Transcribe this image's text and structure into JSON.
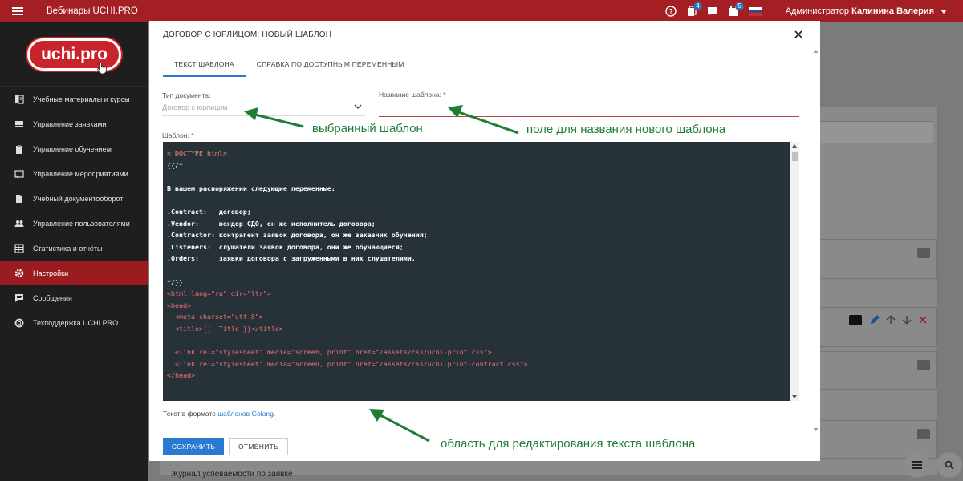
{
  "topbar": {
    "app_title": "Вебинары UCHI.PRO",
    "badge_docs": "4",
    "badge_calendar": "5",
    "user_role": "Администратор",
    "user_name": "Калинина Валерия"
  },
  "sidebar": {
    "logo_text": "uchi.pro",
    "items": [
      {
        "label": "Учебные материалы и курсы",
        "icon": "books-icon"
      },
      {
        "label": "Управление заявками",
        "icon": "list-icon"
      },
      {
        "label": "Управление обучением",
        "icon": "clipboard-icon"
      },
      {
        "label": "Управление мероприятиями",
        "icon": "cast-icon"
      },
      {
        "label": "Учебный документооборот",
        "icon": "document-icon"
      },
      {
        "label": "Управление пользователями",
        "icon": "users-icon"
      },
      {
        "label": "Статистика и отчёты",
        "icon": "table-icon"
      },
      {
        "label": "Настройки",
        "icon": "gear-icon",
        "active": true
      },
      {
        "label": "Сообщения",
        "icon": "message-icon"
      },
      {
        "label": "Техподдержка UCHI.PRO",
        "icon": "support-icon"
      }
    ]
  },
  "background": {
    "journal_label": "Журнал успеваемости по заявке"
  },
  "modal": {
    "title": "ДОГОВОР С ЮРЛИЦОМ: НОВЫЙ ШАБЛОН",
    "tabs": [
      "ТЕКСТ ШАБЛОНА",
      "СПРАВКА ПО ДОСТУПНЫМ ПЕРЕМЕННЫМ"
    ],
    "doc_type_label": "Тип документа:",
    "doc_type_value": "Договор с юрлицом",
    "name_label": "Название шаблона: *",
    "name_value": "",
    "template_label": "Шаблон: *",
    "code_lines": [
      "<!DOCTYPE html>",
      "{{/*",
      "",
      "В вашем распоряжении следующие переменные:",
      "",
      ".Contract:   договор;",
      ".Vendor:     вендор СДО, он же исполнитель договора;",
      ".Contractor: контрагент заявок договора, он же заказчик обучения;",
      ".Listeners:  слушатели заявок договора, они же обучающиеся;",
      ".Orders:     заявки договора с загруженными в них слушателями.",
      "",
      "*/}}",
      "<html lang=\"ru\" dir=\"ltr\">",
      "<head>",
      "  <meta charset=\"utf-8\">",
      "  <title>{{ .Title }}</title>",
      "",
      "  <link rel=\"stylesheet\" media=\"screen, print\" href=\"/assets/css/uchi-print.css\">",
      "  <link rel=\"stylesheet\" media=\"screen, print\" href=\"/assets/css/uchi-print-contract.css\">",
      "</head>"
    ],
    "format_note_prefix": "Текст в формате ",
    "format_note_link": "шаблонов Golang",
    "format_note_suffix": ".",
    "save_label": "СОХРАНИТЬ",
    "cancel_label": "ОТМЕНИТЬ"
  },
  "annotations": {
    "selected_template": "выбранный шаблон",
    "name_field": "поле для названия нового шаблона",
    "edit_area": "область для редактирования текста шаблона"
  },
  "colors": {
    "topbar": "#a31f24",
    "sidebar": "#1e1e1e",
    "active_item": "#9b1c20",
    "primary_button": "#2a7ad2",
    "editor_bg": "#263238",
    "annotation": "#1e7e34"
  }
}
